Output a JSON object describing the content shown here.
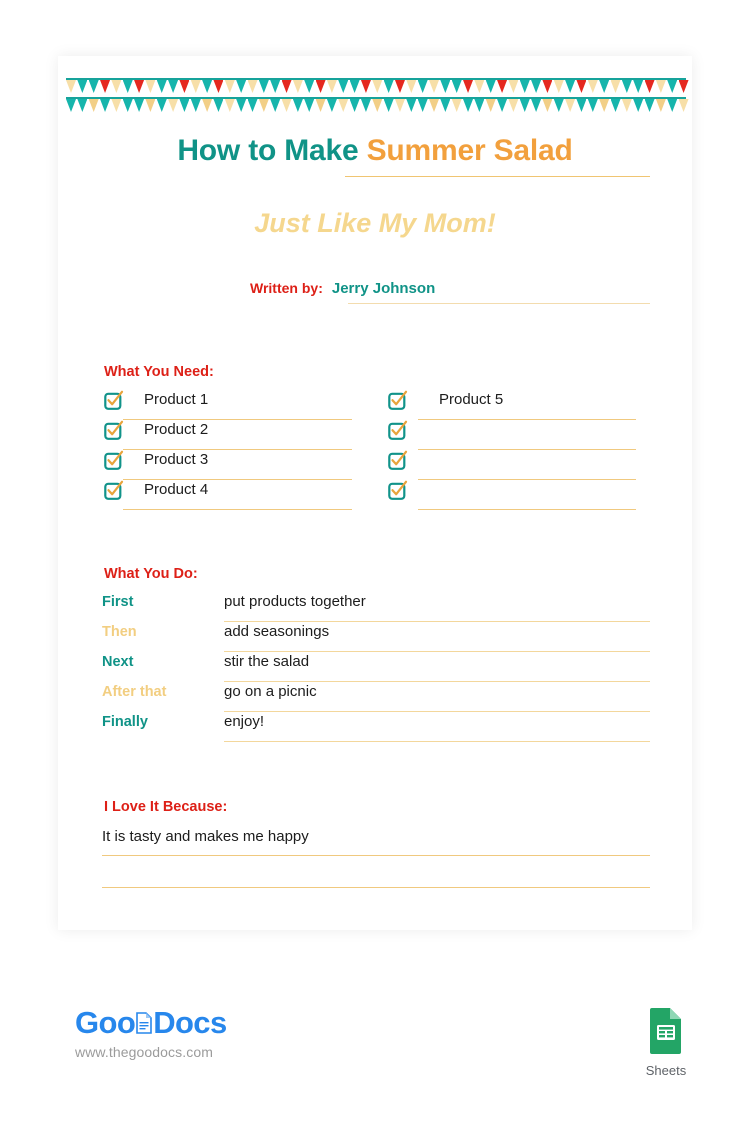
{
  "document": {
    "title_part1": "How to Make",
    "title_part2": "Summer Salad",
    "subtitle": "Just Like My Mom!",
    "author_label": "Written by:",
    "author_name": "Jerry Johnson"
  },
  "colors": {
    "teal": "#109387",
    "orange": "#F2A03D",
    "red": "#DD2017",
    "tan": "#F5D78E",
    "line": "#F0C97F",
    "logo_blue": "#2787EC",
    "sheets_green": "#23A566"
  },
  "needs": {
    "heading": "What You Need:",
    "left_items": [
      "Product 1",
      "Product 2",
      "Product 3",
      "Product 4"
    ],
    "right_items": [
      "Product 5",
      "",
      "",
      ""
    ]
  },
  "steps": {
    "heading": "What You Do:",
    "rows": [
      {
        "label": "First",
        "value": "put products together",
        "label_color": "teal"
      },
      {
        "label": "Then",
        "value": "add seasonings",
        "label_color": "tan"
      },
      {
        "label": "Next",
        "value": "stir the salad",
        "label_color": "teal"
      },
      {
        "label": "After that",
        "value": "go on a picnic",
        "label_color": "tan"
      },
      {
        "label": "Finally",
        "value": "enjoy!",
        "label_color": "teal"
      }
    ]
  },
  "because": {
    "heading": "I Love It Because:",
    "lines": [
      "It is tasty and makes me happy",
      ""
    ]
  },
  "footer": {
    "logo_goo": "Goo",
    "logo_docs": "Docs",
    "url": "www.thegoodocs.com",
    "sheets_label": "Sheets"
  },
  "bunting": {
    "top_pattern": [
      "tan",
      "teal",
      "teal",
      "red",
      "tan",
      "teal",
      "red",
      "tan",
      "teal",
      "teal",
      "red",
      "tan",
      "teal",
      "red",
      "tan",
      "teal"
    ],
    "bottom_pattern": [
      "teal",
      "teal",
      "tan2",
      "teal",
      "tan",
      "teal",
      "teal",
      "tan2",
      "teal",
      "tan"
    ]
  }
}
